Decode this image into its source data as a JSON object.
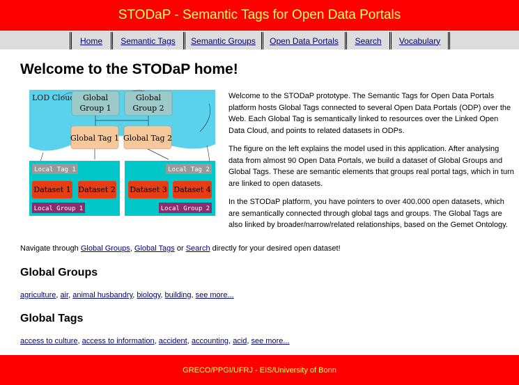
{
  "header": {
    "title": "STODaP - Semantic Tags for Open Data Portals"
  },
  "nav": {
    "items": [
      {
        "label": "Home"
      },
      {
        "label": "Semantic Tags"
      },
      {
        "label": "Semantic Groups"
      },
      {
        "label": "Open Data Portals"
      },
      {
        "label": "Search"
      },
      {
        "label": "Vocabulary"
      }
    ]
  },
  "main": {
    "title": "Welcome to the STODaP home!",
    "figure": {
      "cloud_label": "LOD Cloud",
      "global_group_1": [
        "Global",
        "Group 1"
      ],
      "global_group_2": [
        "Global",
        "Group 2"
      ],
      "global_tag_1": "Global Tag 1",
      "global_tag_2": "Global Tag 2",
      "local_tag_1": "Local Tag 1",
      "local_tag_2": "Local Tag 2",
      "dataset_1": "Dataset 1",
      "dataset_2": "Dataset 2",
      "dataset_3": "Dataset 3",
      "dataset_4": "Dataset 4",
      "local_group_1": "Local Group 1",
      "local_group_2": "Local Group 2"
    },
    "intro_paragraphs": [
      "Welcome to the STODaP prototype. The Semantic Tags for Open Data Portals platform hosts Global Tags connected to several Open Data Portals (ODP) over the Web. Each Global Tag is semantically linked to resources over the Linked Open Data Cloud, and points to related datasets in ODPs.",
      "The figure on the left explains the model used in this application. After analysing data from almost 90 Open Data Portals, we build a dataset of Global Groups and Global Tags. These are semantic elements that groups real portal tags, which in turn are linked to open datasets.",
      "In the STODaP platform, you have pointers to over 400.000 open datasets, which are semantically connected through global tags and groups. The Global Tags are also linked by broader/narrow/related relationships, based on the Gemet Ontology."
    ],
    "navigate": {
      "prefix": "Navigate through ",
      "link1": "Global Groups",
      "sep1": ", ",
      "link2": "Global Tags",
      "sep2": " or ",
      "link3": "Search",
      "suffix": " directly for your desired open dataset!"
    },
    "global_groups": {
      "heading": "Global Groups",
      "items": [
        "agriculture",
        "air",
        "animal husbandry",
        "biology",
        "building"
      ],
      "more": "see more..."
    },
    "global_tags": {
      "heading": "Global Tags",
      "items": [
        "access to culture",
        "access to information",
        "accident",
        "accounting",
        "acid"
      ],
      "more": "see more..."
    }
  },
  "footer": {
    "text": "GRECO/PPGI/UFRJ - EIS/University of Bonn"
  },
  "colors": {
    "header_bg": "#ff0000",
    "header_text": "#ffff66",
    "nav_bg": "#dcdcdc",
    "link": "#00007a",
    "cloud": "#5ad2ec",
    "global_group": "#9ec9c9",
    "global_tag": "#f7c89c",
    "dataset_box": "#00c8c8",
    "dataset": "#e83c14",
    "local_tag": "#999999",
    "local_group": "#8c2c6c"
  }
}
